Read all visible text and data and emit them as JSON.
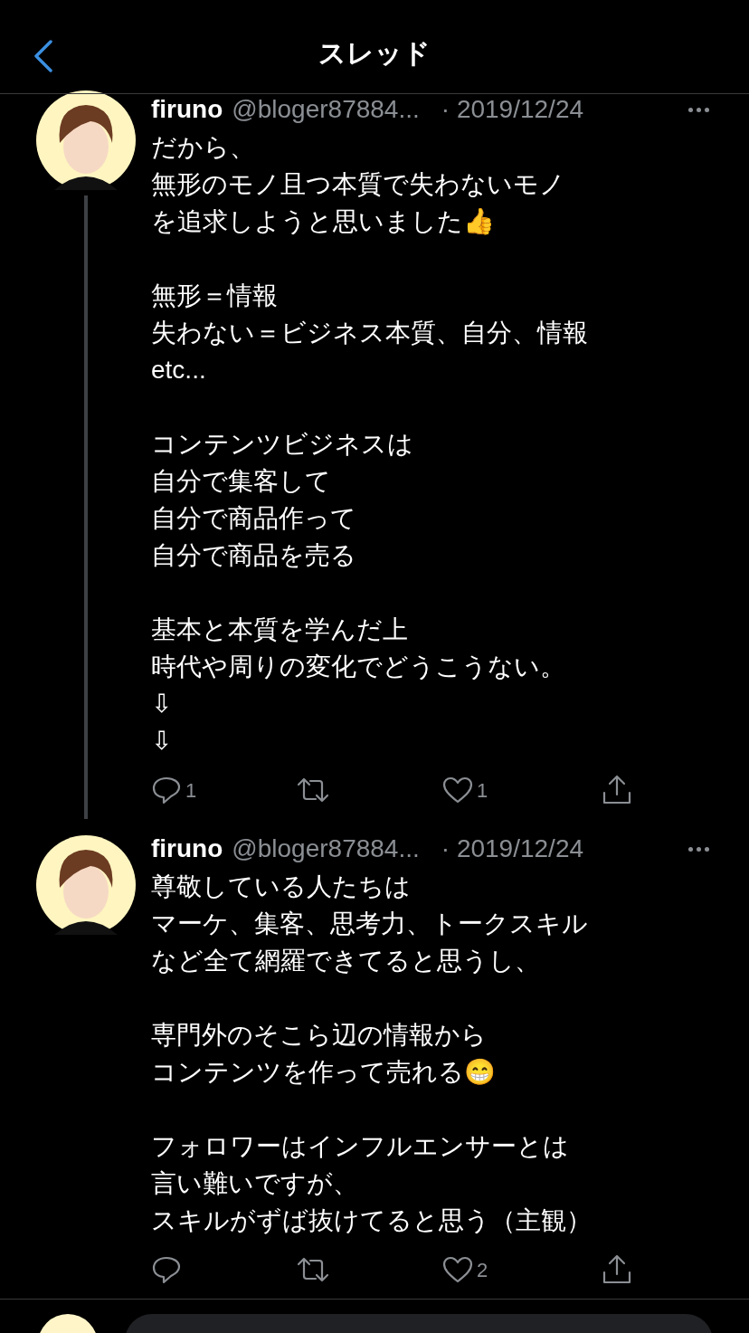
{
  "nav": {
    "title": "スレッド"
  },
  "tweets": [
    {
      "name": "firuno",
      "handle": "@bloger87884...",
      "date": "· 2019/12/24",
      "thread_line": true,
      "paragraphs": [
        [
          "だから、",
          "無形のモノ且つ本質で失わないモノ",
          "を追求しようと思いました👍"
        ],
        [
          "無形＝情報",
          "失わない＝ビジネス本質、自分、情報",
          "etc..."
        ],
        [
          "コンテンツビジネスは",
          "自分で集客して",
          "自分で商品作って",
          "自分で商品を売る"
        ],
        [
          "基本と本質を学んだ上",
          "時代や周りの変化でどうこうない。",
          "⇩",
          "⇩"
        ]
      ],
      "replies": "1",
      "likes": "1"
    },
    {
      "name": "firuno",
      "handle": "@bloger87884...",
      "date": "· 2019/12/24",
      "thread_line": false,
      "paragraphs": [
        [
          "尊敬している人たちは",
          "マーケ、集客、思考力、トークスキル",
          "など全て網羅できてると思うし、"
        ],
        [
          "専門外のそこら辺の情報から",
          "コンテンツを作って売れる😁"
        ],
        [
          "フォロワーはインフルエンサーとは",
          "言い難いですが、",
          "スキルがずば抜けてると思う（主観）"
        ]
      ],
      "likes": "2"
    }
  ]
}
